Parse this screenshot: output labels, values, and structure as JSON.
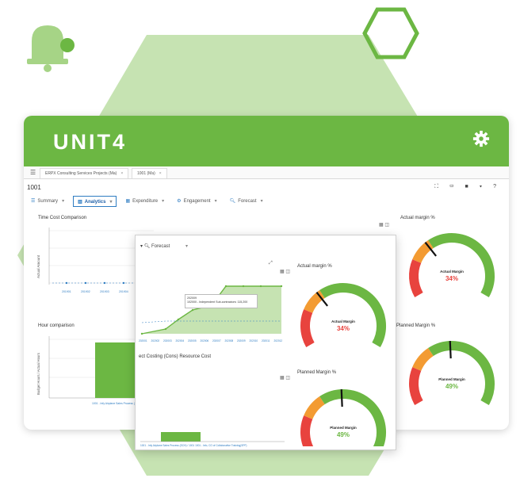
{
  "colors": {
    "brand_green": "#6cb743",
    "light_green": "#c6e3b2",
    "bell_green": "#a6d486",
    "gauge_red": "#e8433e",
    "gauge_orange": "#f39b32",
    "gauge_green": "#6cb743",
    "link_blue": "#2e7cc2"
  },
  "app": {
    "logo": "UNIT4",
    "browser_tabs": [
      {
        "label": "ERPX Consulting Services Projects  (Ma)"
      },
      {
        "label": "1001  (Ma)"
      }
    ],
    "page_id": "1001",
    "toolbar_icons": [
      "fullscreen-icon",
      "layout-icon",
      "bookmark-icon",
      "chevron-down-icon",
      "help-icon"
    ],
    "toolbar_glyphs": "⛶ ▭ ■ ▾ ?",
    "tabs": [
      {
        "label": "Summary",
        "icon": "☰",
        "active": false
      },
      {
        "label": "Analytics",
        "icon": "▥",
        "active": true
      },
      {
        "label": "Expenditure",
        "icon": "▦",
        "active": false
      },
      {
        "label": "Engagement",
        "icon": "⚙",
        "active": false
      },
      {
        "label": "Forecast",
        "icon": "🔍︎",
        "active": false
      }
    ],
    "panels": {
      "time_cost": {
        "title": "Time Cost Comparison",
        "ylabel": "Actual Amount",
        "xlabels": [
          "201901",
          "201902",
          "201903",
          "201904"
        ]
      },
      "hour": {
        "title": "Hour comparison",
        "ylabel": "Budget Hours / Actual Hours",
        "xlabel": "1001 - Infy Airplane Sales Process (SCH)"
      },
      "actual_margin": {
        "title": "Actual margin %",
        "gauge_label": "Actual Margin",
        "value": "34%",
        "fraction": 0.34
      },
      "planned_margin": {
        "title": "Planned Margin %",
        "gauge_label": "Planned Margin",
        "value": "49%",
        "fraction": 0.49
      }
    }
  },
  "front": {
    "tab_label": "Forecast",
    "tooltip": {
      "line1": "202009",
      "line2": "102000 - Independent Sub-contractors: 115,200"
    },
    "xlabels": [
      "202001",
      "202002",
      "202003",
      "202004",
      "202005",
      "202006",
      "202007",
      "202008",
      "202009",
      "202010",
      "202011",
      "202012"
    ],
    "bar_panel_title": "ect Costing (Cons) Resource Cost",
    "bar_xlabel": "1001 - Infy Airplane Sales Process (SCH) / 1001 1001 - Info, CO of Collaborative Training(SPF)",
    "actual_margin": {
      "title": "Actual margin %",
      "gauge_label": "Actual Margin",
      "value": "34%",
      "fraction": 0.34
    },
    "planned_margin": {
      "title": "Planned Margin %",
      "gauge_label": "Planned Margin",
      "value": "49%",
      "fraction": 0.49
    }
  }
}
